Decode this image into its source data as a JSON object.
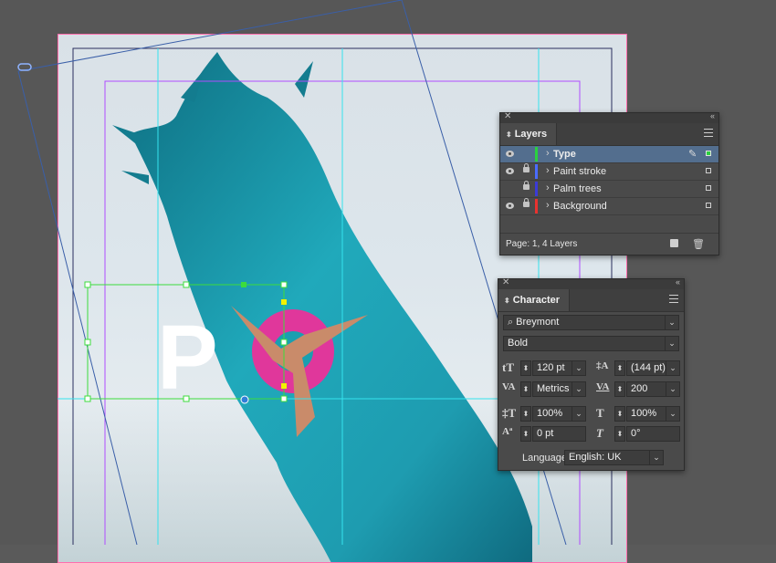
{
  "layers_panel": {
    "title": "Layers",
    "layers": [
      {
        "name": "Type",
        "visible": true,
        "locked": false,
        "selected": true,
        "color": "#2ad13f",
        "pen": true
      },
      {
        "name": "Paint stroke",
        "visible": true,
        "locked": true,
        "selected": false,
        "color": "#4a6cff"
      },
      {
        "name": "Palm trees",
        "visible": false,
        "locked": true,
        "selected": false,
        "color": "#3b3bd6"
      },
      {
        "name": "Background",
        "visible": true,
        "locked": true,
        "selected": false,
        "color": "#e8322f"
      }
    ],
    "status": "Page: 1, 4 Layers"
  },
  "character_panel": {
    "title": "Character",
    "font_family": "Breymont",
    "font_style": "Bold",
    "font_size": "120 pt",
    "leading": "(144 pt)",
    "kerning": "Metrics",
    "tracking": "200",
    "vertical_scale": "100%",
    "horizontal_scale": "100%",
    "baseline_shift": "0 pt",
    "skew": "0°",
    "language_label": "Language:",
    "language": "English: UK"
  },
  "canvas": {
    "text_frame_content": "P",
    "page_edge_color": "#ff6fae",
    "margin_color": "#b04cff",
    "guide_color": "#35e3ee",
    "selection_color": "#3cdc3c",
    "paint_stroke_color": "#1a9fb0",
    "swim_ring_color": "#e0379b"
  }
}
